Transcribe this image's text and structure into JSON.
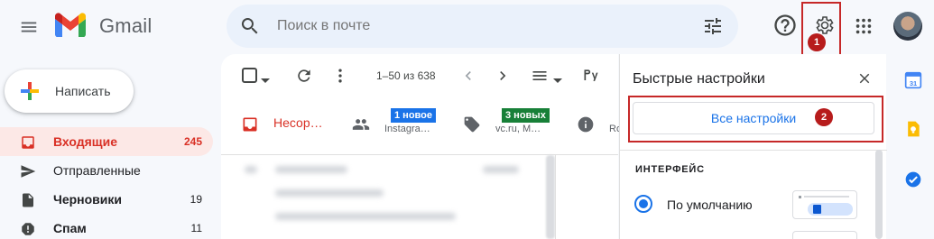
{
  "app": {
    "name": "Gmail"
  },
  "search": {
    "placeholder": "Поиск в почте"
  },
  "annotations": {
    "gear_step": "1",
    "all_settings_step": "2"
  },
  "compose": {
    "label": "Написать"
  },
  "sidebar": {
    "items": [
      {
        "label": "Входящие",
        "count": "245"
      },
      {
        "label": "Отправленные",
        "count": ""
      },
      {
        "label": "Черновики",
        "count": "19"
      },
      {
        "label": "Спам",
        "count": "11"
      }
    ]
  },
  "toolbar": {
    "pager": "1–50 из 638"
  },
  "tabs": [
    {
      "label": "Несор…"
    },
    {
      "chip": "1 новое",
      "sub": "Instagra…",
      "chip_color": "#1a73e8"
    },
    {
      "chip": "3 новых",
      "sub": "vc.ru, M…",
      "chip_color": "#188038"
    },
    {
      "sub": "Ro"
    }
  ],
  "quick_settings": {
    "title": "Быстрые настройки",
    "all_settings_button": "Все настройки",
    "section_title": "ИНТЕРФЕЙС",
    "density_option": "По умолчанию"
  },
  "colors": {
    "accent": "#1a73e8",
    "inbox_red": "#d93025",
    "highlight": "#c62828"
  }
}
